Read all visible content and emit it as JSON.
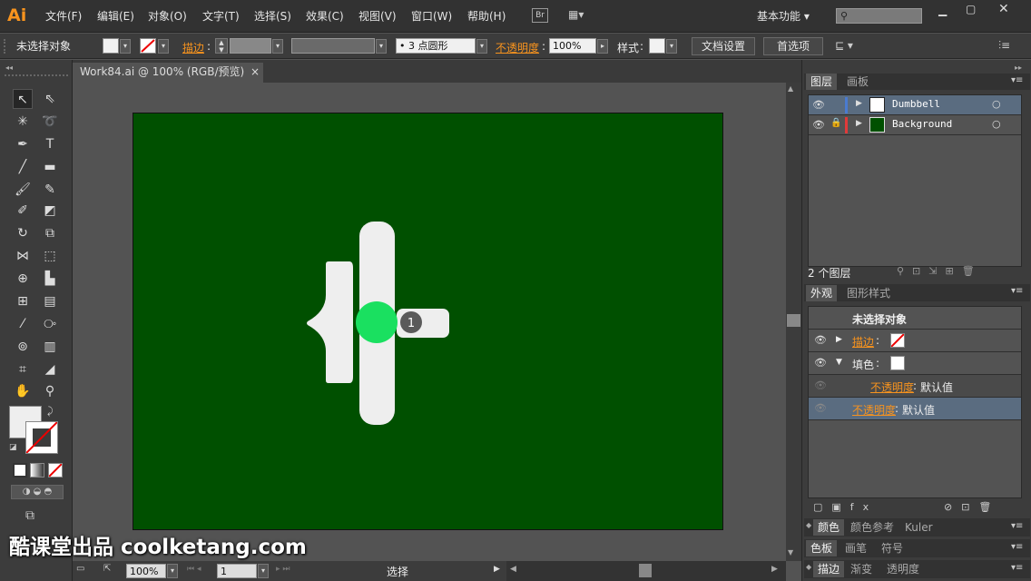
{
  "app": {
    "logo": "Ai"
  },
  "menu": {
    "items": [
      "文件(F)",
      "编辑(E)",
      "对象(O)",
      "文字(T)",
      "选择(S)",
      "效果(C)",
      "视图(V)",
      "窗口(W)",
      "帮助(H)"
    ],
    "bridge": "Br",
    "workspace": "基本功能"
  },
  "control": {
    "selection": "未选择对象",
    "stroke_label": "描边",
    "brush": "• 3 点圆形",
    "opacity_label": "不透明度",
    "opacity_value": "100%",
    "style_label": "样式",
    "doc_setup": "文档设置",
    "prefs": "首选项"
  },
  "document": {
    "tab": "Work84.ai @ 100% (RGB/预览)",
    "close": "×"
  },
  "canvas": {
    "artboard_color": "#005000",
    "badge": "1"
  },
  "status": {
    "zoom": "100%",
    "page": "1",
    "tool": "选择"
  },
  "layers": {
    "tabs": [
      "图层",
      "画板"
    ],
    "items": [
      {
        "name": "Dumbbell",
        "color": "#4a7bd0"
      },
      {
        "name": "Background",
        "color": "#e03a3a"
      }
    ],
    "count": "2 个图层"
  },
  "appearance": {
    "tabs": [
      "外观",
      "图形样式"
    ],
    "title": "未选择对象",
    "stroke": "描边",
    "fill": "填色",
    "opacity_label": "不透明度",
    "opacity_value": "默认值"
  },
  "bottom_panels": [
    [
      "颜色",
      "颜色参考",
      "Kuler"
    ],
    [
      "色板",
      "画笔",
      "符号"
    ],
    [
      "描边",
      "渐变",
      "透明度"
    ]
  ],
  "watermark": "酷课堂出品 coolketang.com"
}
